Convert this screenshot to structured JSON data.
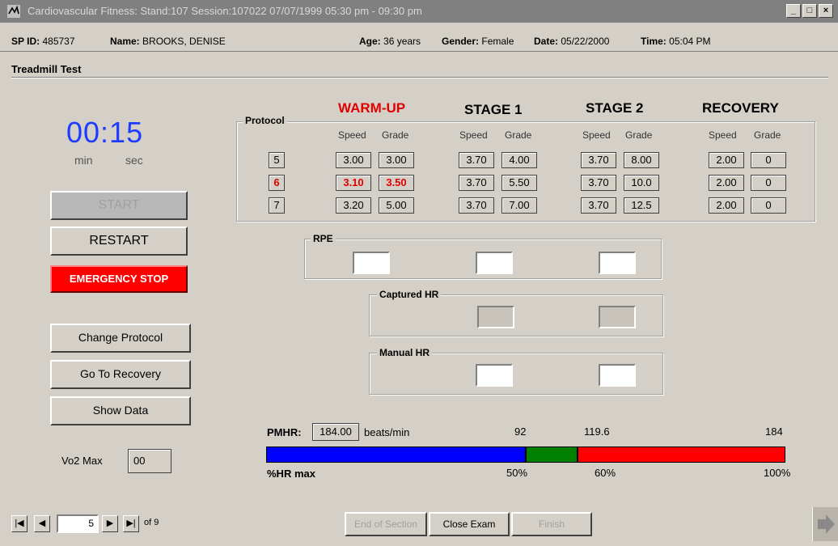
{
  "window": {
    "title": "Cardiovascular Fitness: Stand:107 Session:107022 07/07/1999 05:30 pm - 09:30 pm",
    "min": "_",
    "max": "□",
    "close": "×"
  },
  "header": {
    "sp_id_label": "SP ID:",
    "sp_id": "485737",
    "name_label": "Name:",
    "name": "BROOKS, DENISE",
    "age_label": "Age:",
    "age": "36 years",
    "gender_label": "Gender:",
    "gender": "Female",
    "date_label": "Date:",
    "date": "05/22/2000",
    "time_label": "Time:",
    "time": "05:04 PM"
  },
  "section_title": "Treadmill Test",
  "timer": {
    "value": "00:15",
    "min_label": "min",
    "sec_label": "sec"
  },
  "buttons": {
    "start": "START",
    "restart": "RESTART",
    "emergency_stop": "EMERGENCY STOP",
    "change_protocol": "Change Protocol",
    "go_to_recovery": "Go To Recovery",
    "show_data": "Show Data"
  },
  "vo2": {
    "label": "Vo2 Max",
    "value": "00"
  },
  "protocol": {
    "group_label": "Protocol",
    "stages": [
      "WARM-UP",
      "STAGE 1",
      "STAGE 2",
      "RECOVERY"
    ],
    "speed_label": "Speed",
    "grade_label": "Grade",
    "rows": [
      {
        "protocol": "5",
        "cells": [
          "3.00",
          "3.00",
          "3.70",
          "4.00",
          "3.70",
          "8.00",
          "2.00",
          "0"
        ]
      },
      {
        "protocol": "6",
        "cells": [
          "3.10",
          "3.50",
          "3.70",
          "5.50",
          "3.70",
          "10.0",
          "2.00",
          "0"
        ]
      },
      {
        "protocol": "7",
        "cells": [
          "3.20",
          "5.00",
          "3.70",
          "7.00",
          "3.70",
          "12.5",
          "2.00",
          "0"
        ]
      }
    ],
    "selected_row": 1,
    "highlight_color": "#e00000"
  },
  "rpe": {
    "label": "RPE"
  },
  "captured_hr": {
    "label": "Captured HR"
  },
  "manual_hr": {
    "label": "Manual HR"
  },
  "hr": {
    "pmhr_label": "PMHR:",
    "pmhr_value": "184.00",
    "unit": "beats/min",
    "marks": [
      "92",
      "119.6",
      "184"
    ],
    "pct_label": "%HR max",
    "pcts": [
      "50%",
      "60%",
      "100%"
    ],
    "bar_fractions": [
      0.5,
      0.1,
      0.4
    ],
    "bar_colors": [
      "#0000ff",
      "#008000",
      "#ff0000"
    ]
  },
  "nav": {
    "first": "|◀",
    "prev": "◀",
    "record": "5",
    "next": "▶",
    "last": "▶|",
    "of": "of 9"
  },
  "bottom": {
    "end_of_section": "End of Section",
    "close_exam": "Close Exam",
    "finish": "Finish"
  }
}
